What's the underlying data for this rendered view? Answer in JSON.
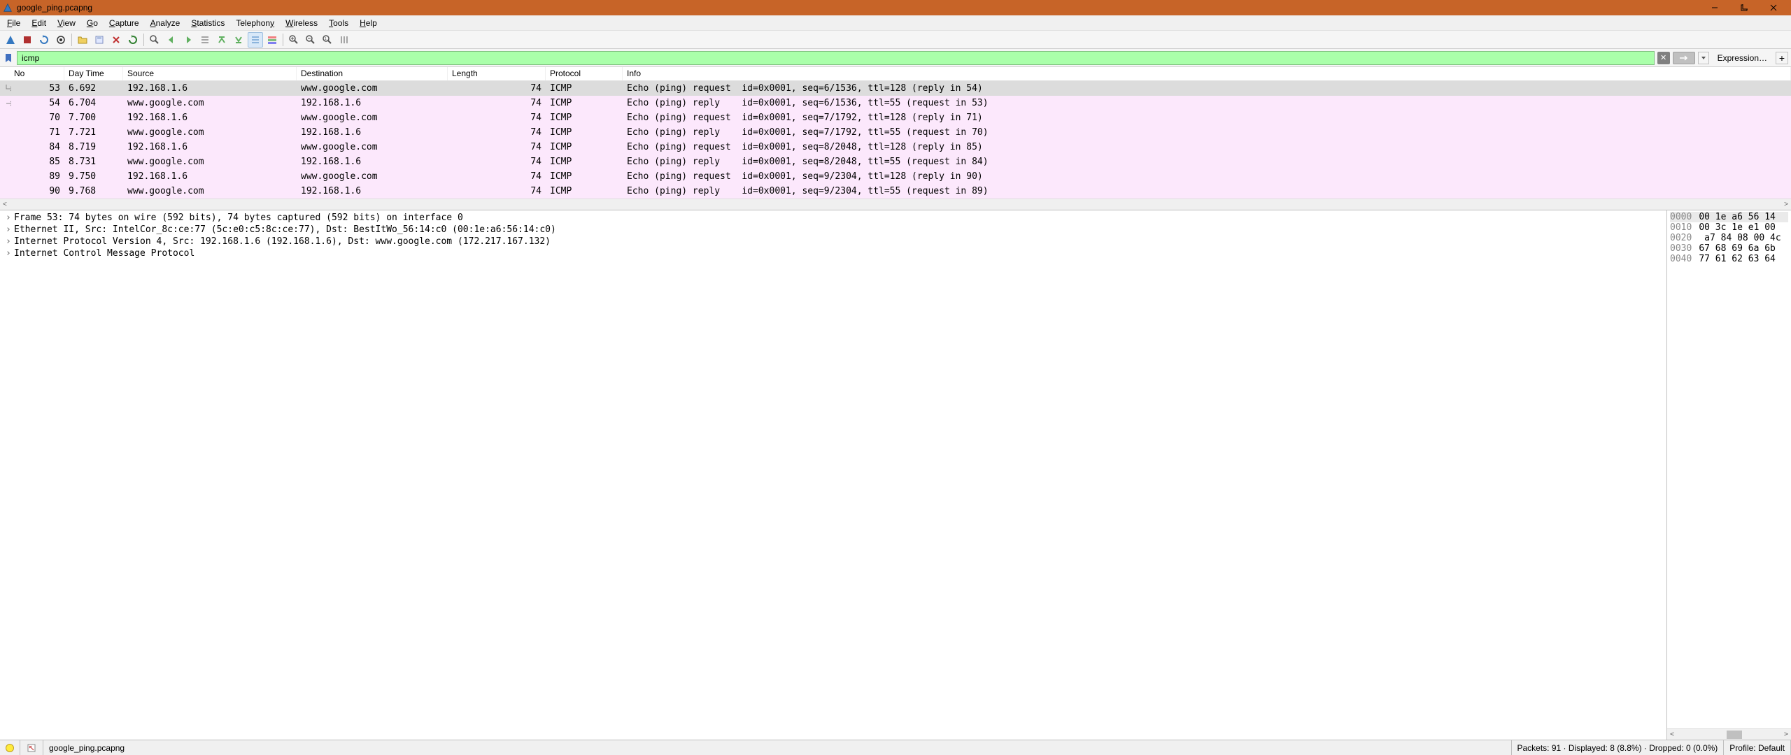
{
  "titlebar": {
    "title": "google_ping.pcapng"
  },
  "menubar": {
    "items": [
      {
        "label": "File",
        "u": 0
      },
      {
        "label": "Edit",
        "u": 0
      },
      {
        "label": "View",
        "u": 0
      },
      {
        "label": "Go",
        "u": 0
      },
      {
        "label": "Capture",
        "u": 0
      },
      {
        "label": "Analyze",
        "u": 0
      },
      {
        "label": "Statistics",
        "u": 0
      },
      {
        "label": "Telephony",
        "u": 8
      },
      {
        "label": "Wireless",
        "u": 0
      },
      {
        "label": "Tools",
        "u": 0
      },
      {
        "label": "Help",
        "u": 0
      }
    ]
  },
  "filter": {
    "value": "icmp",
    "expression_label": "Expression…",
    "plus_label": "+"
  },
  "columns": {
    "no": "No",
    "time": "Day Time",
    "src": "Source",
    "dst": "Destination",
    "len": "Length",
    "proto": "Protocol",
    "info": "Info"
  },
  "packets": [
    {
      "no": "53",
      "time": "6.692",
      "src": "192.168.1.6",
      "dst": "www.google.com",
      "len": "74",
      "proto": "ICMP",
      "info": "Echo (ping) request  id=0x0001, seq=6/1536, ttl=128 (reply in 54)",
      "sel": true,
      "marker": "right"
    },
    {
      "no": "54",
      "time": "6.704",
      "src": "www.google.com",
      "dst": "192.168.1.6",
      "len": "74",
      "proto": "ICMP",
      "info": "Echo (ping) reply    id=0x0001, seq=6/1536, ttl=55 (request in 53)",
      "marker": "left"
    },
    {
      "no": "70",
      "time": "7.700",
      "src": "192.168.1.6",
      "dst": "www.google.com",
      "len": "74",
      "proto": "ICMP",
      "info": "Echo (ping) request  id=0x0001, seq=7/1792, ttl=128 (reply in 71)"
    },
    {
      "no": "71",
      "time": "7.721",
      "src": "www.google.com",
      "dst": "192.168.1.6",
      "len": "74",
      "proto": "ICMP",
      "info": "Echo (ping) reply    id=0x0001, seq=7/1792, ttl=55 (request in 70)"
    },
    {
      "no": "84",
      "time": "8.719",
      "src": "192.168.1.6",
      "dst": "www.google.com",
      "len": "74",
      "proto": "ICMP",
      "info": "Echo (ping) request  id=0x0001, seq=8/2048, ttl=128 (reply in 85)"
    },
    {
      "no": "85",
      "time": "8.731",
      "src": "www.google.com",
      "dst": "192.168.1.6",
      "len": "74",
      "proto": "ICMP",
      "info": "Echo (ping) reply    id=0x0001, seq=8/2048, ttl=55 (request in 84)"
    },
    {
      "no": "89",
      "time": "9.750",
      "src": "192.168.1.6",
      "dst": "www.google.com",
      "len": "74",
      "proto": "ICMP",
      "info": "Echo (ping) request  id=0x0001, seq=9/2304, ttl=128 (reply in 90)"
    },
    {
      "no": "90",
      "time": "9.768",
      "src": "www.google.com",
      "dst": "192.168.1.6",
      "len": "74",
      "proto": "ICMP",
      "info": "Echo (ping) reply    id=0x0001, seq=9/2304, ttl=55 (request in 89)"
    }
  ],
  "details": [
    "Frame 53: 74 bytes on wire (592 bits), 74 bytes captured (592 bits) on interface 0",
    "Ethernet II, Src: IntelCor_8c:ce:77 (5c:e0:c5:8c:ce:77), Dst: BestItWo_56:14:c0 (00:1e:a6:56:14:c0)",
    "Internet Protocol Version 4, Src: 192.168.1.6 (192.168.1.6), Dst: www.google.com (172.217.167.132)",
    "Internet Control Message Protocol"
  ],
  "hex": [
    {
      "off": "0000",
      "bytes": "00 1e a6 56 14"
    },
    {
      "off": "0010",
      "bytes": "00 3c 1e e1 00"
    },
    {
      "off": "0020",
      "bytes": " a7 84 08 00 4c"
    },
    {
      "off": "0030",
      "bytes": "67 68 69 6a 6b"
    },
    {
      "off": "0040",
      "bytes": "77 61 62 63 64"
    }
  ],
  "statusbar": {
    "file": "google_ping.pcapng",
    "stats": "Packets: 91 · Displayed: 8 (8.8%) · Dropped: 0 (0.0%)",
    "profile": "Profile: Default"
  }
}
